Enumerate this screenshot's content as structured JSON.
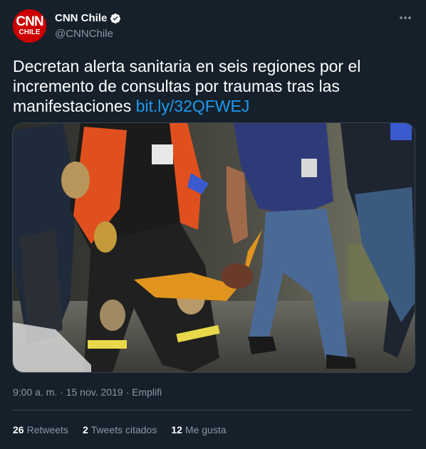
{
  "account": {
    "avatar_line1": "CNN",
    "avatar_line2": "CHILE",
    "display_name": "CNN Chile",
    "handle": "@CNNChile",
    "verified_icon": "verified-badge-icon",
    "brand_color": "#cc0000"
  },
  "tweet": {
    "text": "Decretan alerta sanitaria en seis regiones por el incremento de consultas por traumas tras las manifestaciones ",
    "link": "bit.ly/32QFWEJ",
    "link_color": "#1d9bf0"
  },
  "meta": {
    "time": "9:00 a. m.",
    "separator1": " · ",
    "date": "15 nov. 2019",
    "separator2": " · ",
    "source": "Emplifi"
  },
  "stats": {
    "retweets_count": "26",
    "retweets_label": "Retweets",
    "quotes_count": "2",
    "quotes_label": "Tweets citados",
    "likes_count": "12",
    "likes_label": "Me gusta"
  },
  "colors": {
    "background": "#15202b",
    "secondary_text": "#8b98a5",
    "divider": "#38444d"
  }
}
